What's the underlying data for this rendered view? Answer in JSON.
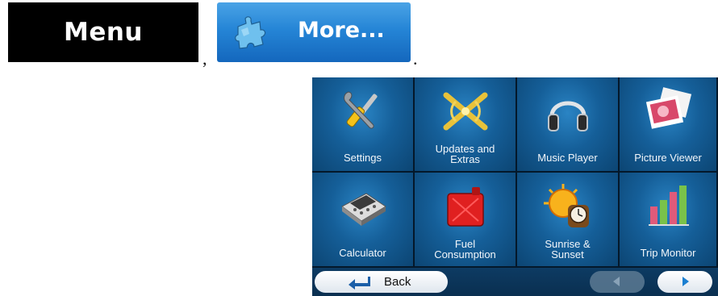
{
  "top_buttons": {
    "menu_label": "Menu",
    "more_label": "More...",
    "comma": ",",
    "period": "."
  },
  "tiles": [
    {
      "label": "Settings",
      "icon": "wrench-screwdriver-icon"
    },
    {
      "label": "Updates and\nExtras",
      "icon": "satellite-signal-icon"
    },
    {
      "label": "Music Player",
      "icon": "headphones-icon"
    },
    {
      "label": "Picture Viewer",
      "icon": "photo-icon"
    },
    {
      "label": "Calculator",
      "icon": "calculator-icon"
    },
    {
      "label": "Fuel\nConsumption",
      "icon": "fuel-can-icon"
    },
    {
      "label": "Sunrise &\nSunset",
      "icon": "sun-clock-icon"
    },
    {
      "label": "Trip Monitor",
      "icon": "bar-chart-icon"
    }
  ],
  "bottom_bar": {
    "back_label": "Back"
  },
  "colors": {
    "tile_blue": "#155f99",
    "panel_dark": "#0b2a44",
    "more_blue": "#2585d6"
  }
}
